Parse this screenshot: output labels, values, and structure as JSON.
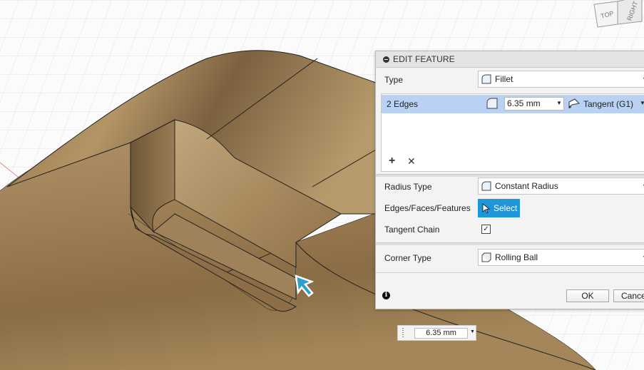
{
  "panel": {
    "title": "EDIT FEATURE",
    "type_label": "Type",
    "type_value": "Fillet",
    "selection": {
      "edges_label": "2 Edges",
      "radius_value": "6.35 mm",
      "tangency_value": "Tangent (G1)"
    },
    "radius_type_label": "Radius Type",
    "radius_type_value": "Constant Radius",
    "edges_faces_label": "Edges/Faces/Features",
    "select_button": "Select",
    "tangent_chain_label": "Tangent Chain",
    "tangent_chain_checked": true,
    "tangent_chain_mark": "✓",
    "corner_type_label": "Corner Type",
    "corner_type_value": "Rolling Ball",
    "ok_button": "OK",
    "cancel_button": "Cance"
  },
  "viewcube": {
    "top_label": "TOP",
    "right_label": "RIGHT"
  },
  "floating_dimension": {
    "value": "6.35 mm"
  },
  "colors": {
    "select_button": "#1e96d8",
    "selected_row": "#b9d2f3",
    "wood": "#a98a5c",
    "grid": "#e3e3e3"
  },
  "icons": [
    "collapse-icon",
    "fillet-icon",
    "tangent-icon",
    "plus-icon",
    "delete-icon",
    "cursor-icon",
    "rolling-ball-icon",
    "info-icon"
  ]
}
